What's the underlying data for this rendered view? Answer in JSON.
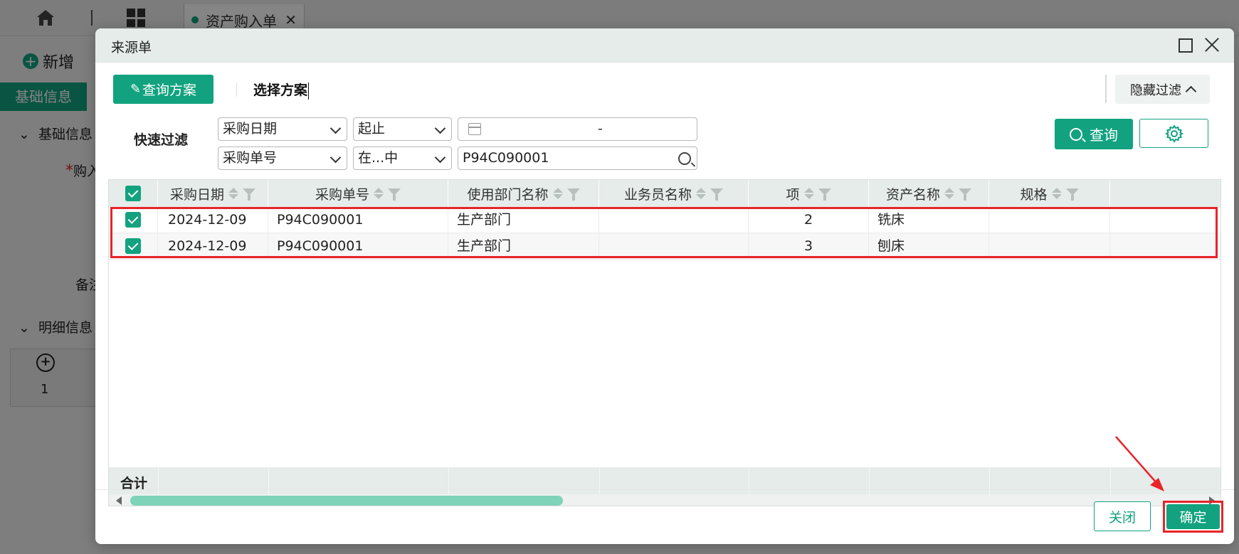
{
  "background": {
    "tab_label": "资产购入单",
    "add_label": "新增",
    "basic_tab": "基础信息",
    "section_basic": "基础信息",
    "field_buyer": "购入",
    "field_remark": "备注",
    "section_detail": "明细信息",
    "row_no": "1"
  },
  "modal": {
    "title": "来源单",
    "scheme_button": "查询方案",
    "select_scheme": "选择方案",
    "hide_filter": "隐藏过滤",
    "quick_filter_label": "快速过滤",
    "filters": [
      {
        "field": "采购日期",
        "operator": "起止",
        "value": "-"
      },
      {
        "field": "采购单号",
        "operator": "在...中",
        "value": "P94C090001"
      }
    ],
    "query_button": "查询",
    "columns": [
      "采购日期",
      "采购单号",
      "使用部门名称",
      "业务员名称",
      "项",
      "资产名称",
      "规格"
    ],
    "rows": [
      {
        "date": "2024-12-09",
        "order_no": "P94C090001",
        "dept": "生产部门",
        "staff": "",
        "item": "2",
        "asset": "铣床",
        "spec": ""
      },
      {
        "date": "2024-12-09",
        "order_no": "P94C090001",
        "dept": "生产部门",
        "staff": "",
        "item": "3",
        "asset": "刨床",
        "spec": ""
      }
    ],
    "footer_label": "合计",
    "close_button": "关闭",
    "confirm_button": "确定"
  },
  "colors": {
    "accent": "#12a27f",
    "highlight": "#e8242a",
    "header_bg": "#e6ecea"
  }
}
